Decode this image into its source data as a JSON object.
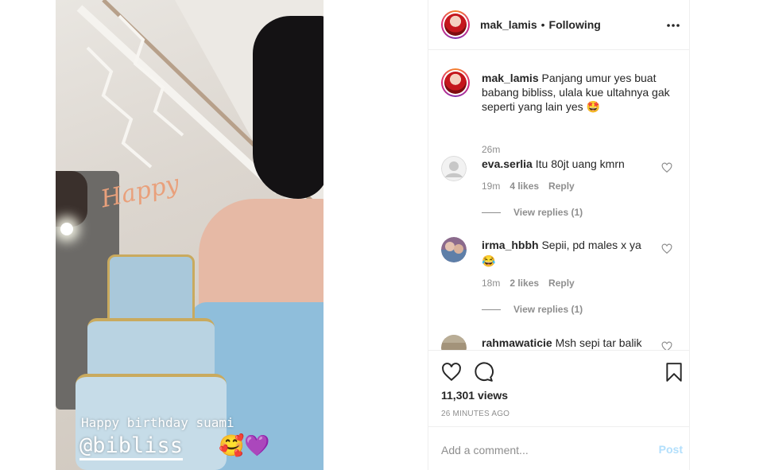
{
  "video": {
    "caption_line1": "Happy birthday suami",
    "caption_mention": "@bibliss",
    "caption_emojis": "🥰💜",
    "cake_topper": "Happy"
  },
  "header": {
    "username": "mak_lamis",
    "separator": "•",
    "follow_status": "Following",
    "more_icon": "more-horizontal-icon"
  },
  "caption": {
    "username": "mak_lamis",
    "text": "Panjang umur yes buat babang bibliss, ulala kue ultahnya gak seperti yang lain yes 🤩",
    "time": "26m"
  },
  "comments": [
    {
      "username": "eva.serlia",
      "text": "Itu 80jt uang kmrn",
      "time": "19m",
      "likes": "4 likes",
      "reply_label": "Reply",
      "view_replies": "View replies (1)"
    },
    {
      "username": "irma_hbbh",
      "text": "Sepii, pd males x ya 😂",
      "time": "18m",
      "likes": "2 likes",
      "reply_label": "Reply",
      "view_replies": "View replies (1)"
    },
    {
      "username": "rahmawaticie",
      "text": "Msh sepi tar balik"
    }
  ],
  "actions": {
    "views": "11,301 views",
    "ago": "26 MINUTES AGO"
  },
  "add_comment": {
    "placeholder": "Add a comment...",
    "post_label": "Post"
  },
  "colors": {
    "post_button_disabled": "#b2dffc",
    "meta_gray": "#8e8e8e",
    "text": "#262626",
    "divider": "#efefef"
  }
}
